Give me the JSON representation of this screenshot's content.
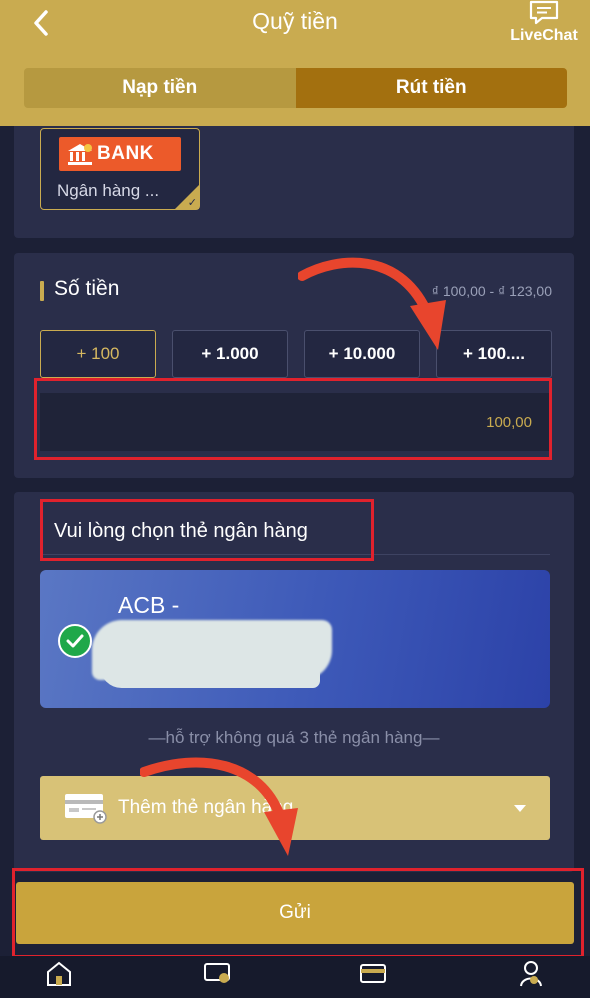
{
  "header": {
    "title": "Quỹ tiền",
    "livechat_label": "LiveChat",
    "tabs": [
      {
        "label": "Nạp tiền",
        "active": false
      },
      {
        "label": "Rút tiền",
        "active": true
      }
    ]
  },
  "bank_method": {
    "logo_text": "BANK",
    "name": "Ngân hàng ..."
  },
  "amount": {
    "title": "Số tiền",
    "range": "₫ 100,00 - ₫ 123,00",
    "chips": [
      "+ 100",
      "+ 1.000",
      "+ 10.000",
      "+ 100...."
    ],
    "input_value": "100,00"
  },
  "card_section": {
    "title": "Vui lòng chọn thẻ ngân hàng",
    "card_name": "ACB -",
    "support_text": "—hỗ trợ không quá 3 thẻ ngân hàng—",
    "add_card_label": "Thêm thẻ ngân hàng"
  },
  "submit_label": "Gửi",
  "colors": {
    "accent_gold": "#c9ab50",
    "active_tab": "#a3700f",
    "annotation_red": "#e0222d",
    "card_blue": "#3d59b8"
  },
  "icons": {
    "back": "chevron-left-icon",
    "livechat": "chat-bubble-icon",
    "nav": [
      "home-icon",
      "ticket-icon",
      "card-icon",
      "profile-icon"
    ]
  }
}
